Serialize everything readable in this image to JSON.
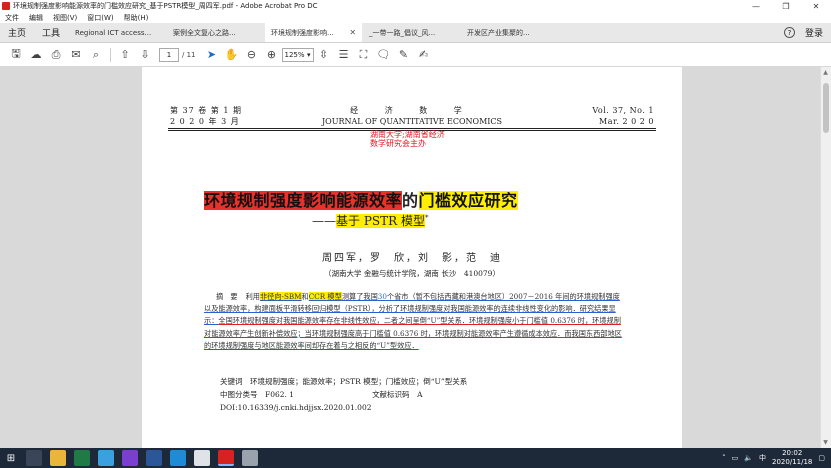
{
  "window": {
    "title": "环境规制强度影响能源效率的门槛效应研究_基于PSTR模型_周四军.pdf - Adobe Acrobat Pro DC",
    "minimize": "—",
    "restore": "❐",
    "close": "✕"
  },
  "menu": [
    "文件",
    "编辑",
    "视图(V)",
    "窗口(W)",
    "帮助(H)"
  ],
  "tabs": {
    "home": "主页",
    "tools": "工具",
    "documents": [
      {
        "label": "Regional ICT access...",
        "active": false
      },
      {
        "label": "案例全文复心之路...",
        "active": false
      },
      {
        "label": "环境规制强度影响...",
        "active": true
      },
      {
        "label": "_一带一路_倡议_风...",
        "active": false
      },
      {
        "label": "开发区产业集聚的...",
        "active": false
      }
    ],
    "help": "?",
    "signin": "登录"
  },
  "toolbar": {
    "page_current": "1",
    "page_total": "/ 11",
    "zoom": "125%"
  },
  "paper": {
    "header_left_1": "第 37 卷 第 1 期",
    "header_left_2": "2 0 2 0 年 3 月",
    "header_center_cn": "经 济 数 学",
    "header_center_en": "JOURNAL OF QUANTITATIVE ECONOMICS",
    "header_right_1": "Vol. 37, No. 1",
    "header_right_2": "Mar. 2 0 2 0",
    "stamp_1": "湖南大学;湖南省经济",
    "stamp_2": "数学研究会主办",
    "title_part1": "环境规制强度影响能源效率",
    "title_part2": "的",
    "title_part3": "门槛效应研究",
    "subtitle_dash": "——",
    "subtitle": "基于 PSTR 模型",
    "subtitle_mark": "*",
    "authors": "周四军，罗　欣，刘　影，范　迪",
    "affiliation": "（湖南大学 金融与统计学院，湖南 长沙　410079）",
    "abstract": {
      "label": "摘　要",
      "s1": "利用",
      "s2": "非径向-SBM",
      "s3": "和",
      "s4": "CCR 模型",
      "s5": "测算了我国",
      "s6": "30",
      "s7": "个省市（暂不包括西藏和港澳台地区）2007－2016 年间的环境规制强度以及能源效率",
      "s8": "，构建面板平滑转移回归模型（PSTR），分析了环境规制强度对我国能源效率的连续非线性变化的影响．研究结果显示：",
      "s9": "全国环境规制强度对我国能源效率存在非线性效应，二者之间呈倒“U”型关系．环境规制强度小于门槛值 0.6376 时，环境规制对能源效率产生创新补偿效应；当环境规制强度高于门槛值 0.6376 时，环境规制对能源效率产生遵循成本效应．而我国东西部地区的环境规制强度与地区能源效率间却存在着与之相反的“U”型效应．"
    },
    "keywords_label": "关键词",
    "keywords": "环境规制强度；能源效率；PSTR 模型；门槛效应；倒“U”型关系",
    "clc_label": "中图分类号",
    "clc": "F062. 1",
    "doc_code_label": "文献标识码",
    "doc_code": "A",
    "doi": "DOI:10.16339/j.cnki.hdjjsx.2020.01.002"
  },
  "taskbar": {
    "start": "⊞",
    "time": "20:02",
    "date": "2020/11/18",
    "tray_lang": "中"
  },
  "colors": {
    "highlight_red": "#e8312b",
    "highlight_yellow": "#ffee00",
    "stamp_red": "#e0141e",
    "taskbar": "#1d2838"
  }
}
